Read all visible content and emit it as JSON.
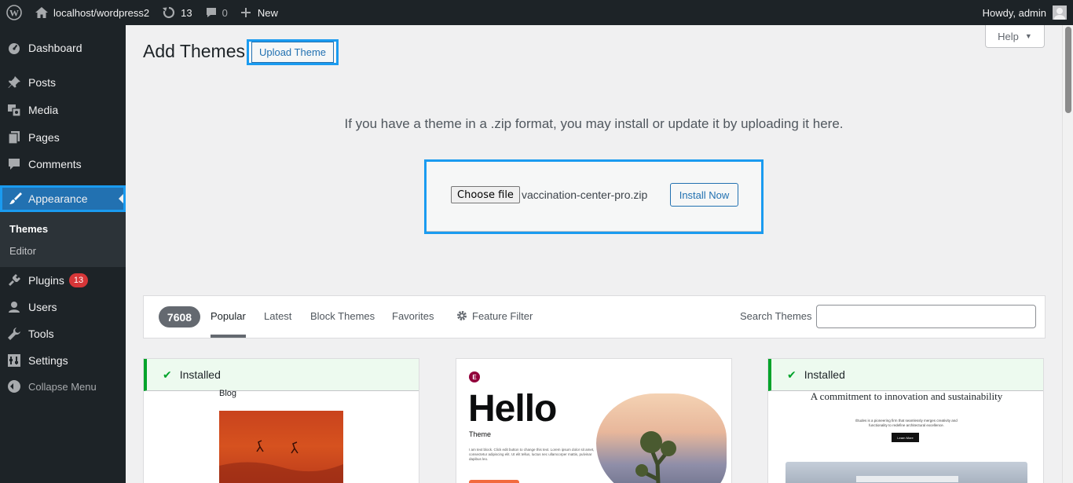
{
  "adminbar": {
    "site_name": "localhost/wordpress2",
    "updates_count": "13",
    "comments_count": "0",
    "new_label": "New",
    "howdy": "Howdy, admin"
  },
  "sidebar": {
    "items": [
      {
        "label": "Dashboard",
        "icon": "dashboard-icon"
      },
      {
        "label": "Posts",
        "icon": "pin-icon"
      },
      {
        "label": "Media",
        "icon": "media-icon"
      },
      {
        "label": "Pages",
        "icon": "pages-icon"
      },
      {
        "label": "Comments",
        "icon": "comments-icon"
      },
      {
        "label": "Appearance",
        "icon": "paintbrush-icon"
      },
      {
        "label": "Plugins",
        "icon": "plug-icon",
        "badge": "13"
      },
      {
        "label": "Users",
        "icon": "user-icon"
      },
      {
        "label": "Tools",
        "icon": "wrench-icon"
      },
      {
        "label": "Settings",
        "icon": "settings-icon"
      }
    ],
    "submenu": [
      "Themes",
      "Editor"
    ],
    "collapse_label": "Collapse Menu"
  },
  "header": {
    "help_label": "Help",
    "title": "Add Themes",
    "upload_theme_label": "Upload Theme"
  },
  "upload": {
    "intro": "If you have a theme in a .zip format, you may install or update it by uploading it here.",
    "choose_file_label": "Choose file",
    "file_name": "vaccination-center-pro.zip",
    "install_label": "Install Now"
  },
  "filter": {
    "count": "7608",
    "tabs": [
      "Popular",
      "Latest",
      "Block Themes",
      "Favorites"
    ],
    "feature_filter": "Feature Filter",
    "search_label": "Search Themes",
    "search_value": ""
  },
  "themes": {
    "installed_label": "Installed",
    "card1": {
      "blog_label": "Blog"
    },
    "card2": {
      "title": "Hello",
      "subtitle": "Theme",
      "lorem": "I am text block. Click edit button to change this text. Lorem ipsum dolor sit amet, consectetur adipiscing elit. Ut elit tellus, luctus nec ullamcorper mattis, pulvinar dapibus leo."
    },
    "card3": {
      "title": "A commitment to innovation and sustainability",
      "body": "Études is a pioneering firm that seamlessly merges creativity and functionality to redefine architectural excellence.",
      "button": "Learn More"
    }
  },
  "colors": {
    "adminbar_bg": "#1d2327",
    "accent": "#2271b1",
    "highlight": "#1a9bf0",
    "badge": "#d63638",
    "installed": "#00a32a"
  }
}
